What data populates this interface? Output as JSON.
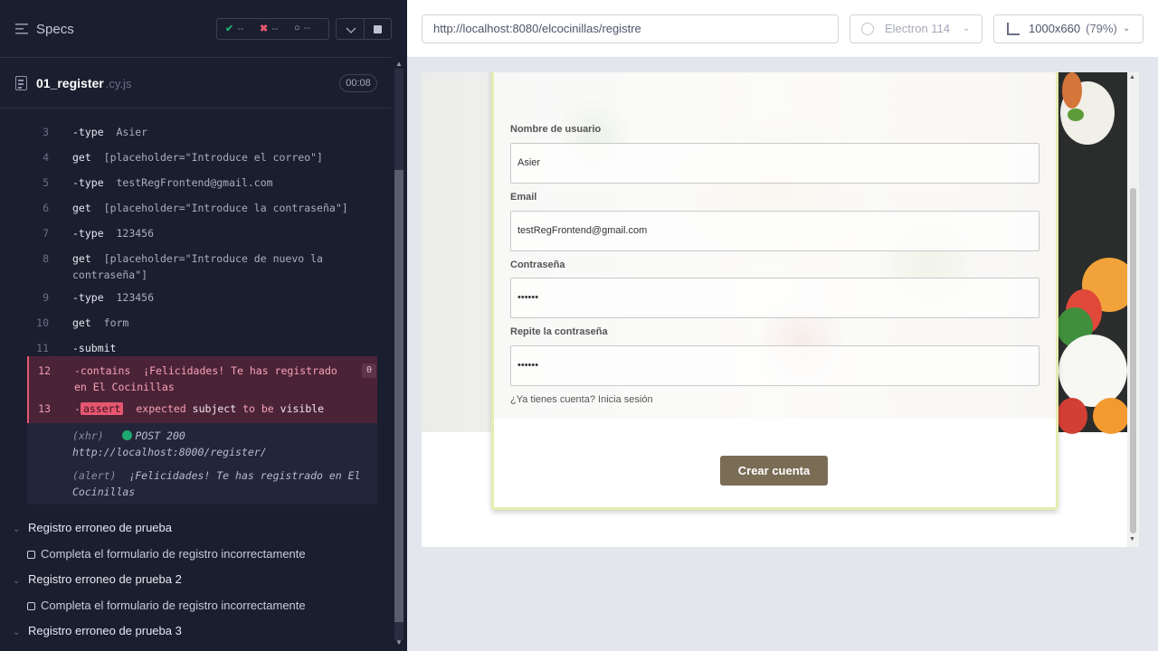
{
  "runner": {
    "specs_label": "Specs",
    "stats": {
      "passed": "--",
      "failed": "--",
      "pending": "--"
    },
    "spec": {
      "name": "01_register",
      "ext": ".cy.js",
      "duration": "00:08"
    }
  },
  "commands": [
    {
      "num": "3",
      "name": "-type",
      "arg": "Asier"
    },
    {
      "num": "4",
      "name": "get",
      "arg": "[placeholder=\"Introduce el correo\"]"
    },
    {
      "num": "5",
      "name": "-type",
      "arg": "testRegFrontend@gmail.com"
    },
    {
      "num": "6",
      "name": "get",
      "arg": "[placeholder=\"Introduce la contraseña\"]"
    },
    {
      "num": "7",
      "name": "-type",
      "arg": "123456"
    },
    {
      "num": "8",
      "name": "get",
      "arg": "[placeholder=\"Introduce de nuevo la contraseña\"]"
    },
    {
      "num": "9",
      "name": "-type",
      "arg": "123456"
    },
    {
      "num": "10",
      "name": "get",
      "arg": "form"
    },
    {
      "num": "11",
      "name": "-submit",
      "arg": ""
    },
    {
      "num": "12",
      "name": "-contains",
      "arg": "¡Felicidades! Te has registrado en El Cocinillas",
      "badge": "0"
    },
    {
      "num": "13",
      "prefix": "-",
      "tag": "assert",
      "arg": "expected",
      "b1": "subject",
      "mid": "to be",
      "b2": "visible"
    }
  ],
  "logs": [
    {
      "tag": "(xhr)",
      "text": "POST 200",
      "text2": "http://localhost:8000/register/"
    },
    {
      "tag": "(alert)",
      "text": "¡Felicidades! Te has registrado en El Cocinillas"
    }
  ],
  "suites": [
    {
      "title": "Registro erroneo de prueba",
      "test": "Completa el formulario de registro incorrectamente"
    },
    {
      "title": "Registro erroneo de prueba 2",
      "test": "Completa el formulario de registro incorrectamente"
    },
    {
      "title": "Registro erroneo de prueba 3"
    }
  ],
  "preview": {
    "url": "http://localhost:8080/elcocinillas/registre",
    "browser": "Electron 114",
    "viewport": "1000x660",
    "zoom": "(79%)"
  },
  "form": {
    "username_label": "Nombre de usuario",
    "username_value": "Asier",
    "email_label": "Email",
    "email_value": "testRegFrontend@gmail.com",
    "password_label": "Contraseña",
    "password_value": "••••••",
    "repeat_label": "Repite la contraseña",
    "repeat_value": "••••••",
    "login_link": "¿Ya tienes cuenta? Inicia sesión",
    "submit": "Crear cuenta"
  },
  "colors": {
    "error": "#e45770",
    "pass": "#1fa971",
    "button": "#7a6c55",
    "card_border": "#e6ecb0"
  }
}
